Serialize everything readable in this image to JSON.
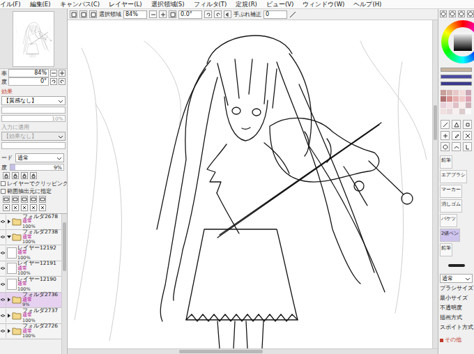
{
  "menu": [
    "イル(F)",
    "編集(E)",
    "キャンバス(C)",
    "レイヤー(L)",
    "選択領域(S)",
    "フィルタ(T)",
    "定規(R)",
    "ビュー(V)",
    "ウィンドウ(W)",
    "ヘルプ(H)"
  ],
  "toolbar": {
    "selection_label": "選択領域",
    "zoom": "84%",
    "angle": "0.0°",
    "stabilizer_label": "手ぶれ補正",
    "stabilizer": "0"
  },
  "navigator": {
    "zoom_label": "率",
    "zoom": "84%",
    "angle_label": "度",
    "angle": "0°"
  },
  "effects": {
    "title": "効果",
    "texture": "【質感なし】",
    "texture_sliders": [
      {
        "reading": "",
        "level": 0
      },
      {
        "reading": "10%",
        "level": 0
      }
    ],
    "apply_label": "入力に適用",
    "effect": "【効果なし】",
    "disabled": true
  },
  "layer_props": {
    "mode_label": "ード",
    "mode": "通常",
    "opacity_label": "度",
    "opacity": "9%",
    "opacity_level": 0.09,
    "options": [
      {
        "label": "レイヤーでクリッピング",
        "checked": false
      },
      {
        "label": "範囲抽出元に指定",
        "checked": false
      }
    ]
  },
  "layers": [
    {
      "name": "フォルダ2678",
      "mode": "通常",
      "opacity": "100%",
      "kind": "folder",
      "expanded": false,
      "selected": false,
      "visible": true
    },
    {
      "name": "フォルダ2738",
      "mode": "通常",
      "opacity": "100%",
      "kind": "folder",
      "expanded": true,
      "selected": false,
      "visible": true
    },
    {
      "name": "レイヤー12192",
      "mode": "通常",
      "opacity": "100%",
      "kind": "layer",
      "expanded": false,
      "selected": false,
      "visible": true
    },
    {
      "name": "レイヤー12191",
      "mode": "通常",
      "opacity": "100%",
      "kind": "layer",
      "expanded": false,
      "selected": false,
      "visible": true
    },
    {
      "name": "レイヤー12190",
      "mode": "通常",
      "opacity": "100%",
      "kind": "layer",
      "expanded": false,
      "selected": false,
      "visible": true
    },
    {
      "name": "フォルダ2736",
      "mode": "通常",
      "opacity": "9%",
      "kind": "folder",
      "expanded": false,
      "selected": true,
      "visible": true
    },
    {
      "name": "フォルダ2737",
      "mode": "通常",
      "opacity": "100%",
      "kind": "folder",
      "expanded": false,
      "selected": false,
      "visible": true
    },
    {
      "name": "フォルダ2726",
      "mode": "通常",
      "opacity": "100%",
      "kind": "folder",
      "expanded": false,
      "selected": false,
      "visible": true
    }
  ],
  "colors": {
    "bars": [
      "#c9b59d",
      "#4b4ba3",
      "#3a3a8e"
    ],
    "swatches": [
      "#c9a09a",
      "#d8b4b0",
      "#e8c8c8",
      "#f2dcdc",
      "#caa6b4",
      "#b07070",
      "#d89090",
      "#e8b0b0",
      "#f0c8c8",
      "#dca0b0",
      "#e8d0d8",
      "#f4e0e4",
      "#e0c0c8",
      "#f8ecec",
      "#d0b0b8",
      "#f0e0e0",
      "#e8d8dc",
      "#f8f0f0",
      "#dccccc",
      "#fafafa"
    ]
  },
  "tools": [
    {
      "label": "鉛筆",
      "selected": false
    },
    {
      "label": "エアブラシ",
      "selected": false
    },
    {
      "label": "マーカー",
      "selected": false
    },
    {
      "label": "消しゴム",
      "selected": false
    },
    {
      "label": "バケツ",
      "selected": false
    },
    {
      "label": "2値ペン",
      "selected": true
    },
    {
      "label": "鉛筆",
      "selected": false
    }
  ],
  "brush": {
    "blend": "通常",
    "settings": [
      "ブラシサイズ",
      "最小サイズ",
      "不透明度",
      "描画方式",
      "スポイト方式"
    ],
    "more": "その他"
  }
}
